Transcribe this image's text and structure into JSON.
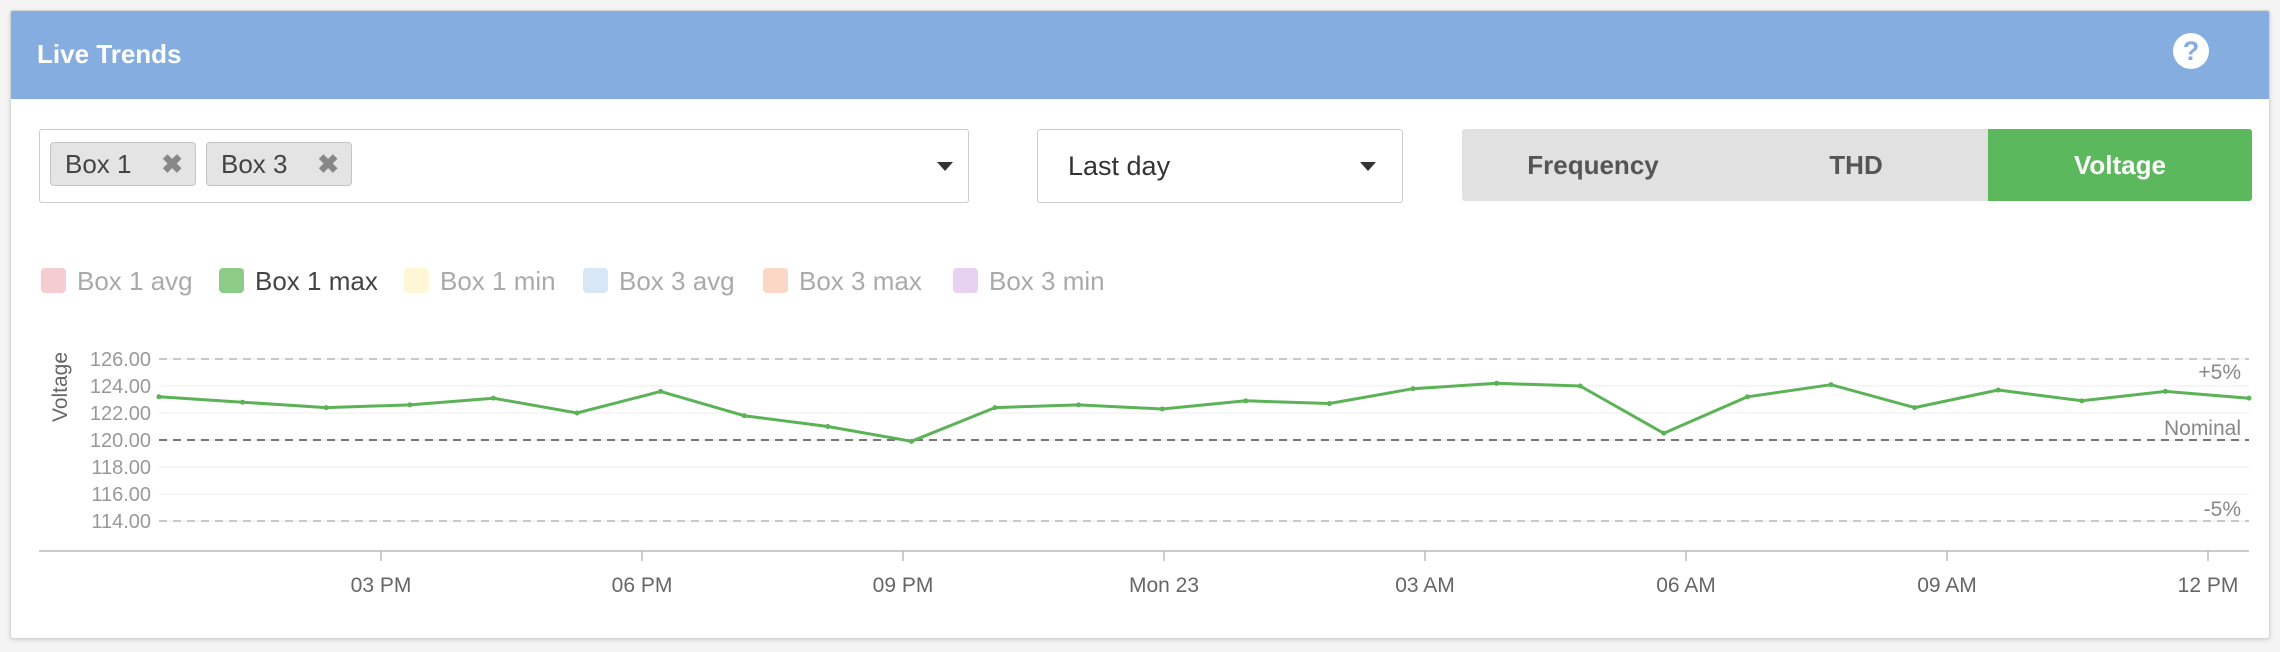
{
  "header": {
    "title": "Live Trends",
    "help_icon": "question-circle-icon"
  },
  "box_select": {
    "selected": [
      {
        "label": "Box 1"
      },
      {
        "label": "Box 3"
      }
    ],
    "remove_glyph": "✖"
  },
  "range_select": {
    "value": "Last day"
  },
  "metric_toggle": {
    "options": [
      "Frequency",
      "THD",
      "Voltage"
    ],
    "active": "Voltage",
    "active_color": "#5cb85c"
  },
  "chart_data": {
    "type": "line",
    "ylabel": "Voltage",
    "y_ticks": [
      "126.00",
      "124.00",
      "122.00",
      "120.00",
      "118.00",
      "116.00",
      "114.00"
    ],
    "ylim": [
      114,
      126
    ],
    "x_ticks": [
      "03 PM",
      "06 PM",
      "09 PM",
      "Mon 23",
      "03 AM",
      "06 AM",
      "09 AM",
      "12 PM"
    ],
    "reference_lines": [
      {
        "label": "+5%",
        "value": 126
      },
      {
        "label": "Nominal",
        "value": 120
      },
      {
        "label": "-5%",
        "value": 114
      }
    ],
    "legend": [
      {
        "name": "Box 1 avg",
        "color": "#f5ccd1",
        "visible": false
      },
      {
        "name": "Box 1 max",
        "color": "#8ccc86",
        "visible": true
      },
      {
        "name": "Box 1 min",
        "color": "#fff6d5",
        "visible": false
      },
      {
        "name": "Box 3 avg",
        "color": "#d7e7f5",
        "visible": false
      },
      {
        "name": "Box 3 max",
        "color": "#fbd8c6",
        "visible": false
      },
      {
        "name": "Box 3 min",
        "color": "#e7d2f2",
        "visible": false
      }
    ],
    "series": [
      {
        "name": "Box 1 max",
        "color": "#5cb257",
        "x": [
          "12 PM",
          "01 PM",
          "02 PM",
          "03 PM",
          "04 PM",
          "05 PM",
          "06 PM",
          "07 PM",
          "08 PM",
          "09 PM",
          "10 PM",
          "11 PM",
          "Mon 23",
          "01 AM",
          "02 AM",
          "03 AM",
          "04 AM",
          "05 AM",
          "06 AM",
          "07 AM",
          "08 AM",
          "09 AM",
          "10 AM",
          "11 AM",
          "12 PM",
          "12 PM"
        ],
        "values": [
          123.2,
          122.8,
          122.4,
          122.6,
          123.1,
          122.0,
          123.6,
          121.8,
          121.0,
          119.9,
          122.4,
          122.6,
          122.3,
          122.9,
          122.7,
          123.8,
          124.2,
          124.0,
          120.5,
          123.2,
          124.1,
          122.4,
          123.7,
          122.9,
          123.6,
          123.1
        ]
      }
    ]
  }
}
